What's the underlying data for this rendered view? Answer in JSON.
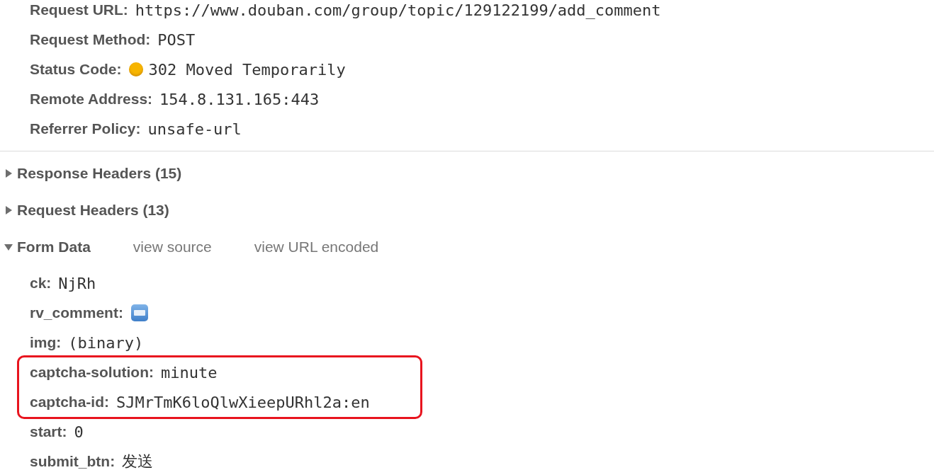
{
  "general": [
    {
      "label": "Request URL:",
      "value": "https://www.douban.com/group/topic/129122199/add_comment"
    },
    {
      "label": "Request Method:",
      "value": "POST"
    },
    {
      "label": "Status Code:",
      "value": "302 Moved Temporarily",
      "color": "#f7b500"
    },
    {
      "label": "Remote Address:",
      "value": "154.8.131.165:443"
    },
    {
      "label": "Referrer Policy:",
      "value": "unsafe-url"
    }
  ],
  "sections": [
    {
      "title": "Response Headers (15)",
      "expanded": false
    },
    {
      "title": "Request Headers (13)",
      "expanded": false
    },
    {
      "title": "Form Data",
      "expanded": true,
      "links": [
        "view source",
        "view URL encoded"
      ]
    }
  ],
  "form_data": [
    {
      "name": "ck:",
      "value": "NjRh",
      "highlighted": false
    },
    {
      "name": "rv_comment:",
      "kind": "icon",
      "highlighted": false
    },
    {
      "name": "img:",
      "value": "(binary)",
      "highlighted": false
    },
    {
      "name": "captcha-solution:",
      "value": "minute",
      "highlighted": true
    },
    {
      "name": "captcha-id:",
      "value": "SJMrTmK6loQlwXieepURhl2a:en",
      "highlighted": true
    },
    {
      "name": "start:",
      "value": "0",
      "highlighted": false
    },
    {
      "name": "submit_btn:",
      "value": "发送",
      "highlighted": false
    }
  ]
}
